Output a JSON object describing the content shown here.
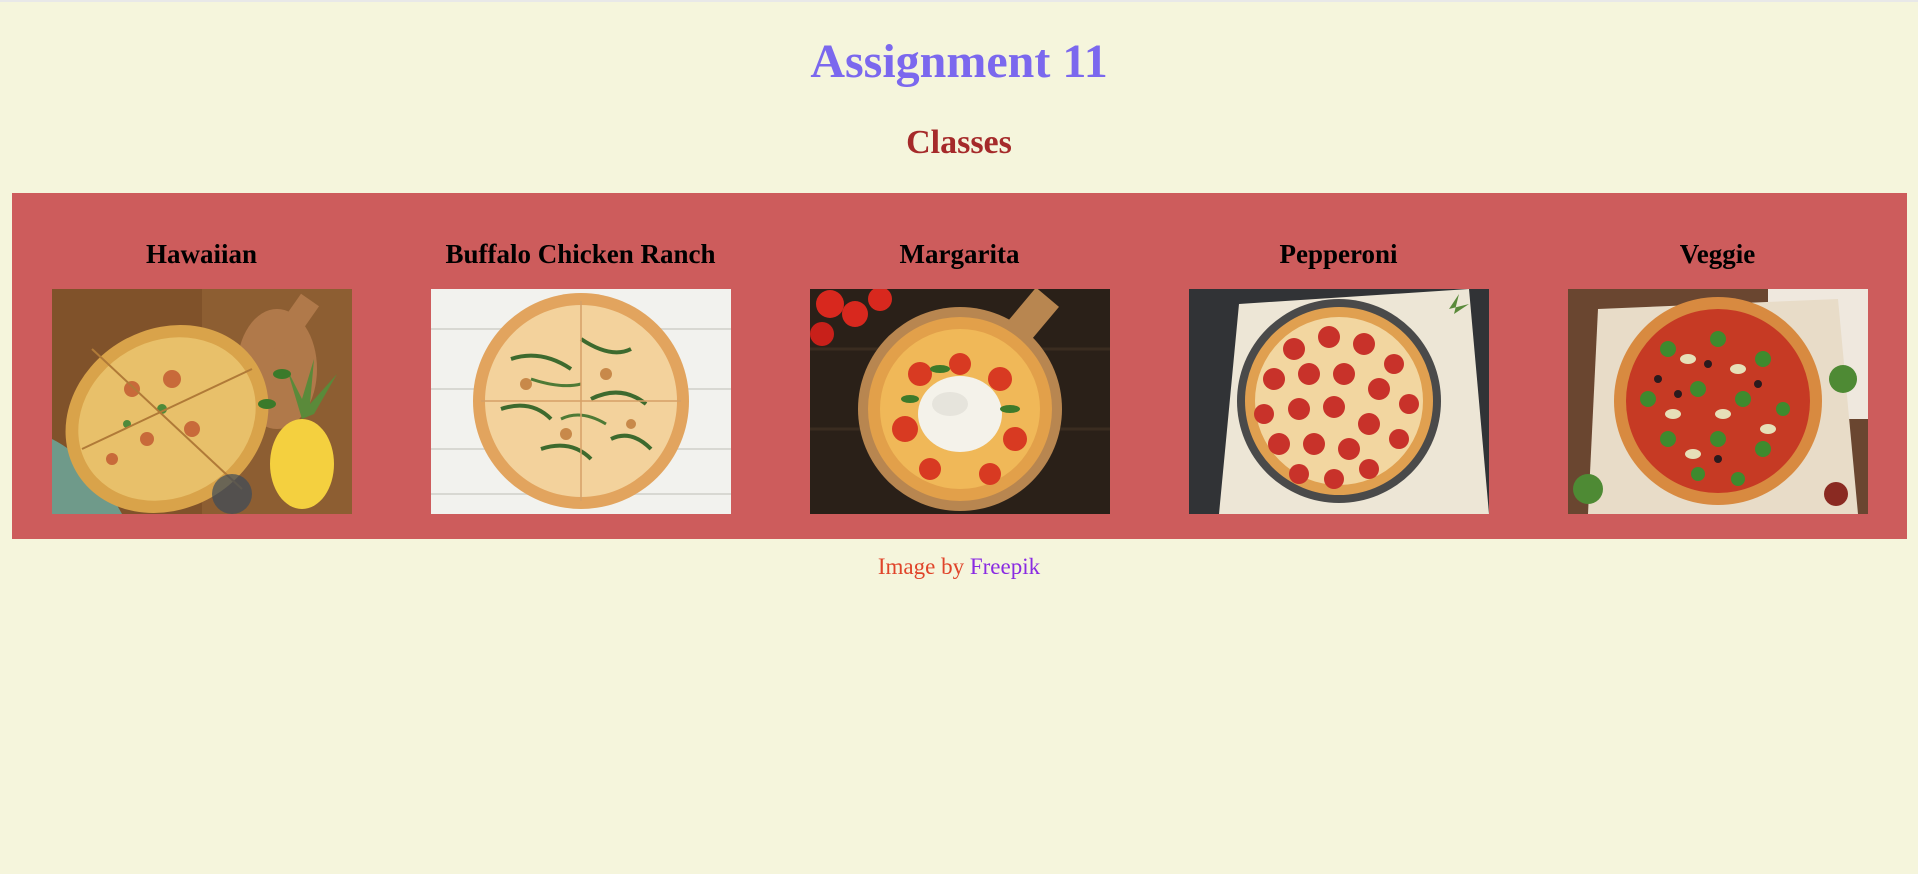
{
  "colors": {
    "page_bg": "#f5f5dc",
    "title": "#7b68ee",
    "subtitle": "#a52a2a",
    "band_bg": "#cd5c5c",
    "credit_text": "#e0442a",
    "credit_link": "#8a2be2"
  },
  "page": {
    "title": "Assignment 11",
    "subtitle": "Classes"
  },
  "pizzas": [
    {
      "name": "Hawaiian",
      "image_icon": "hawaiian-pizza-photo"
    },
    {
      "name": "Buffalo Chicken Ranch",
      "image_icon": "buffalo-chicken-ranch-pizza-photo"
    },
    {
      "name": "Margarita",
      "image_icon": "margarita-pizza-photo"
    },
    {
      "name": "Pepperoni",
      "image_icon": "pepperoni-pizza-photo"
    },
    {
      "name": "Veggie",
      "image_icon": "veggie-pizza-photo"
    }
  ],
  "credit": {
    "prefix": "Image by",
    "link_text": "Freepik"
  }
}
